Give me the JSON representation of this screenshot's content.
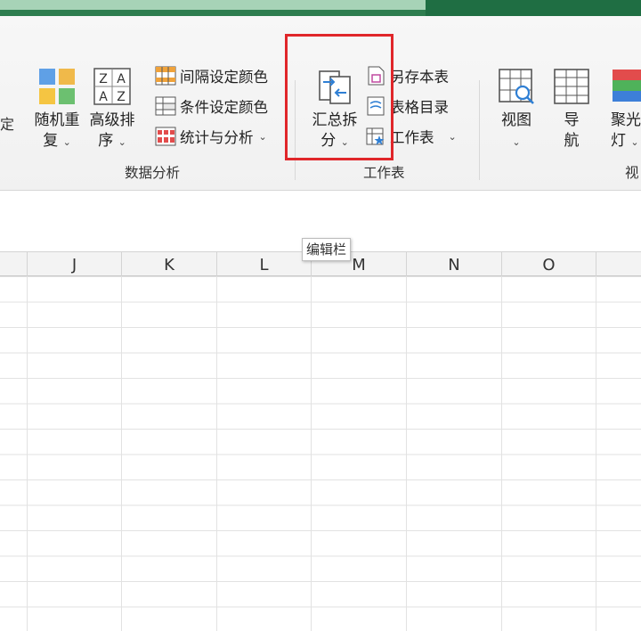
{
  "ribbon": {
    "edge_glyph": "定",
    "random_repeat": {
      "line1": "随机重",
      "line2": "复",
      "caret": "⌄"
    },
    "advanced_sort": {
      "line1": "高级排",
      "line2": "序",
      "caret": "⌄",
      "icon_letters": [
        "Z",
        "A",
        "A",
        "Z"
      ]
    },
    "interval_color": "间隔设定颜色",
    "conditional_color": "条件设定颜色",
    "stats_analysis": "统计与分析",
    "stats_caret": "⌄",
    "data_analysis_group": "数据分析",
    "summary_split": {
      "line1": "汇总拆",
      "line2": "分",
      "caret": "⌄"
    },
    "save_this_sheet": "另存本表",
    "sheet_directory": "表格目录",
    "worksheet": "工作表",
    "worksheet_caret": "⌄",
    "worksheet_group": "工作表",
    "view": {
      "line1": "视图",
      "caret": "⌄"
    },
    "navigation": {
      "line1": "导",
      "line2": "航"
    },
    "spotlight": {
      "line1": "聚光",
      "line2": "灯",
      "caret": "⌄"
    },
    "view_group_partial": "视"
  },
  "tooltip": "编辑栏",
  "columns": [
    "J",
    "K",
    "L",
    "M",
    "N",
    "O"
  ],
  "colors": {
    "title_bar": "#1f6e43",
    "highlight_border": "#e0262a"
  }
}
